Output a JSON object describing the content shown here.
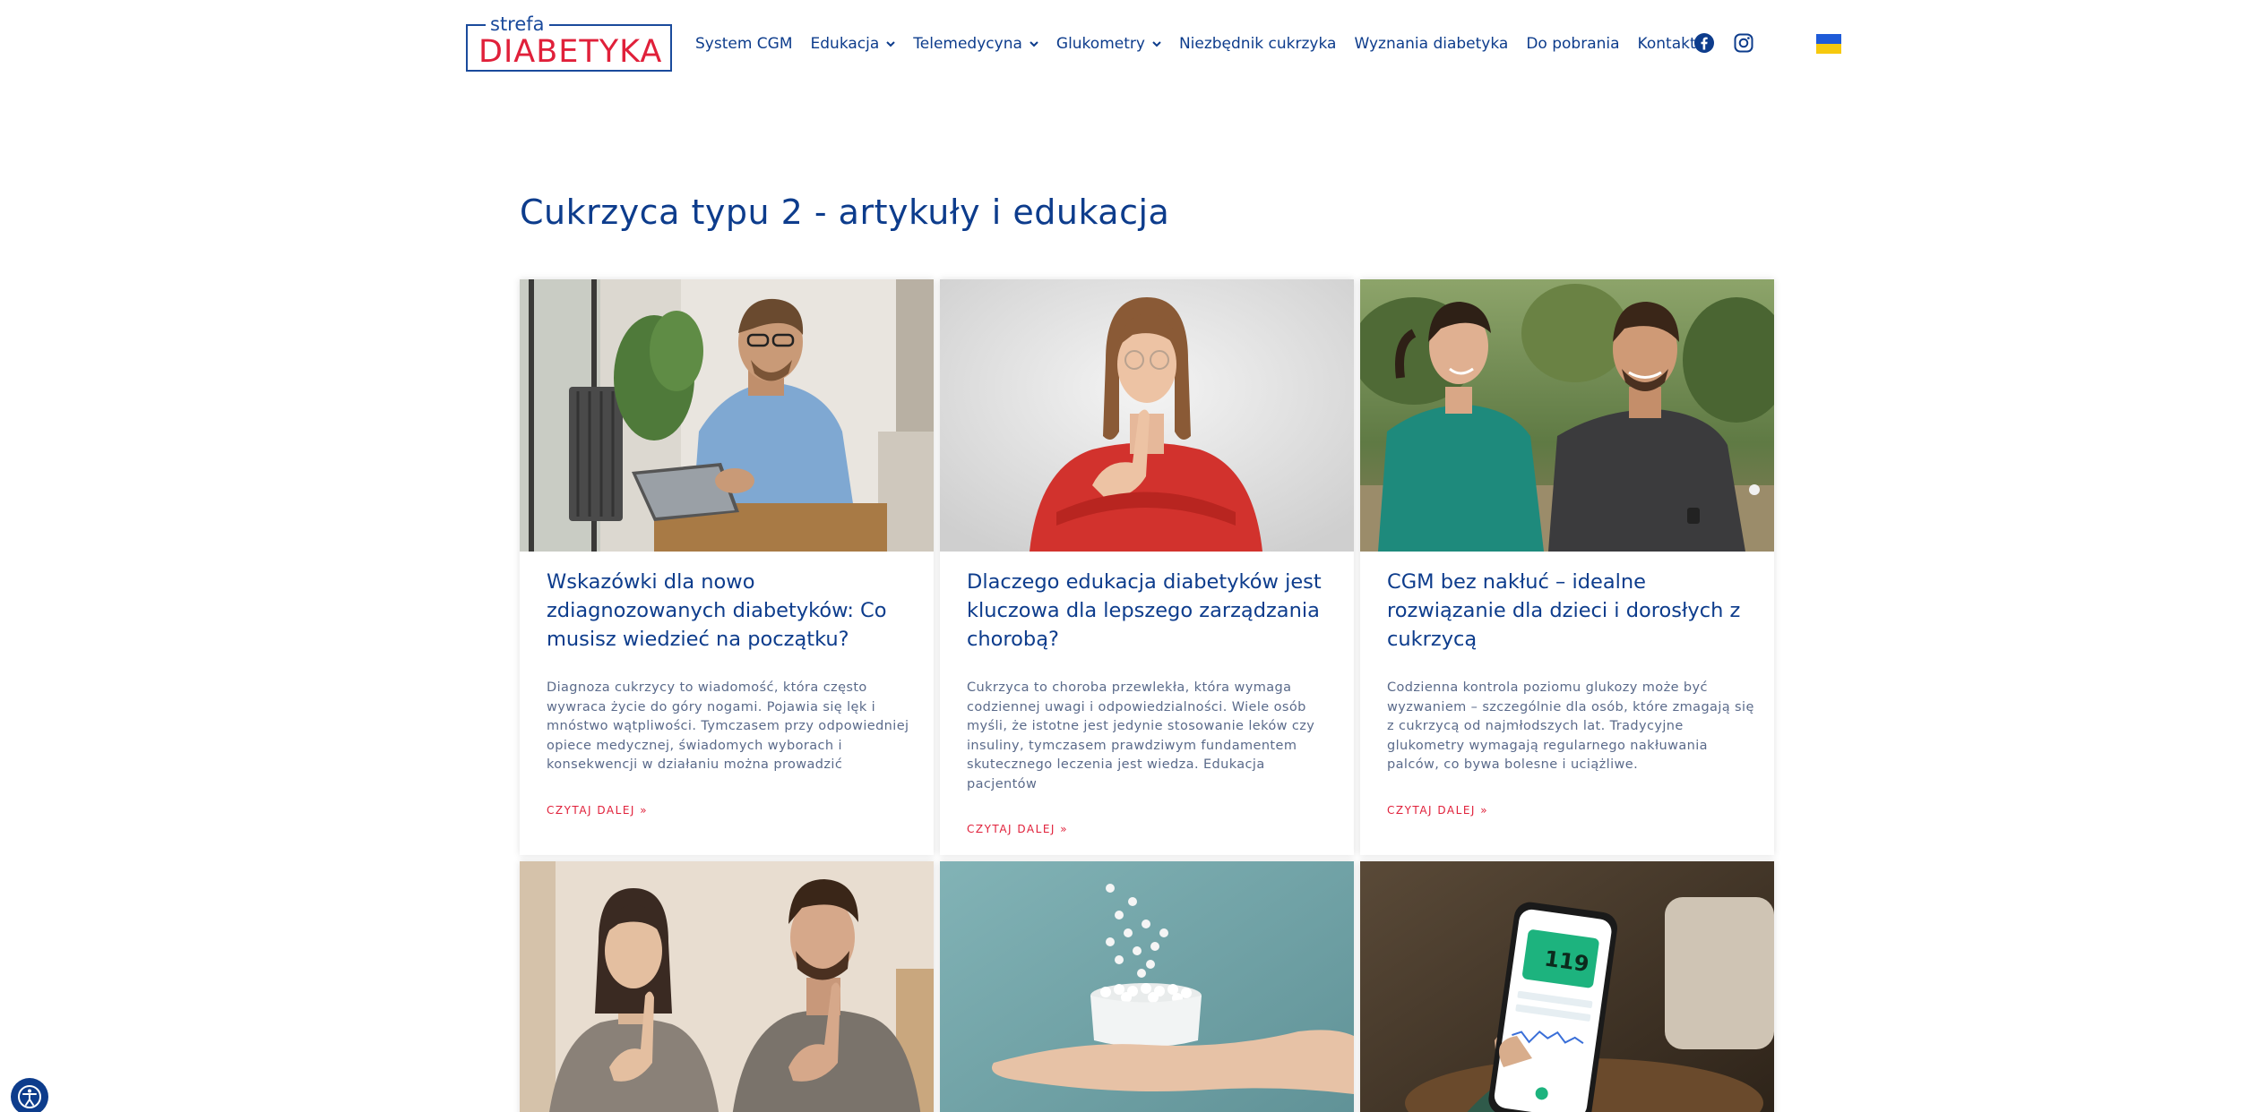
{
  "logo": {
    "small": "strefa",
    "big": "DIABETYKA"
  },
  "nav": {
    "items": [
      {
        "label": "System CGM",
        "dropdown": false
      },
      {
        "label": "Edukacja",
        "dropdown": true
      },
      {
        "label": "Telemedycyna",
        "dropdown": true
      },
      {
        "label": "Glukometry",
        "dropdown": true
      },
      {
        "label": "Niezbędnik cukrzyka",
        "dropdown": false
      },
      {
        "label": "Wyznania diabetyka",
        "dropdown": false
      },
      {
        "label": "Do pobrania",
        "dropdown": false
      },
      {
        "label": "Kontakt",
        "dropdown": false
      }
    ],
    "social": [
      "facebook-icon",
      "instagram-icon"
    ],
    "language_flag": "ukraine-flag"
  },
  "page": {
    "title": "Cukrzyca typu 2 - artykuły i edukacja"
  },
  "articles": [
    {
      "title": "Wskazówki dla nowo zdiagnozowanych diabetyków: Co musisz wiedzieć na początku?",
      "excerpt": "Diagnoza cukrzycy to wiadomość, która często wywraca życie do góry nogami. Pojawia się lęk i mnóstwo wątpliwości. Tymczasem przy odpowiedniej opiece medycznej, świadomych wyborach i konsekwencji w działaniu można prowadzić",
      "more": "CZYTAJ DALEJ »",
      "image": "man-reading-tablet"
    },
    {
      "title": "Dlaczego edukacja diabetyków jest kluczowa dla lepszego zarządzania chorobą?",
      "excerpt": "Cukrzyca to choroba przewlekła, która wymaga codziennej uwagi i odpowiedzialności. Wiele osób myśli, że istotne jest jedynie stosowanie leków czy insuliny, tymczasem prawdziwym fundamentem skutecznego leczenia jest wiedza. Edukacja pacjentów",
      "more": "CZYTAJ DALEJ »",
      "image": "woman-thinking"
    },
    {
      "title": "CGM bez nakłuć – idealne rozwiązanie dla dzieci i dorosłych z cukrzycą",
      "excerpt": "Codzienna kontrola poziomu glukozy może być wyzwaniem – szczególnie dla osób, które zmagają się z cukrzycą od najmłodszych lat. Tradycyjne glukometry wymagają regularnego nakłuwania palców, co bywa bolesne i uciążliwe.",
      "more": "CZYTAJ DALEJ »",
      "image": "couple-running"
    },
    {
      "image": "couple-thinking"
    },
    {
      "image": "hand-with-pills"
    },
    {
      "image": "phone-cgm-app",
      "phone_reading": "119"
    }
  ],
  "colors": {
    "brand_blue": "#0d3c8c",
    "brand_red": "#e0203a",
    "excerpt": "#5a6a8a"
  }
}
